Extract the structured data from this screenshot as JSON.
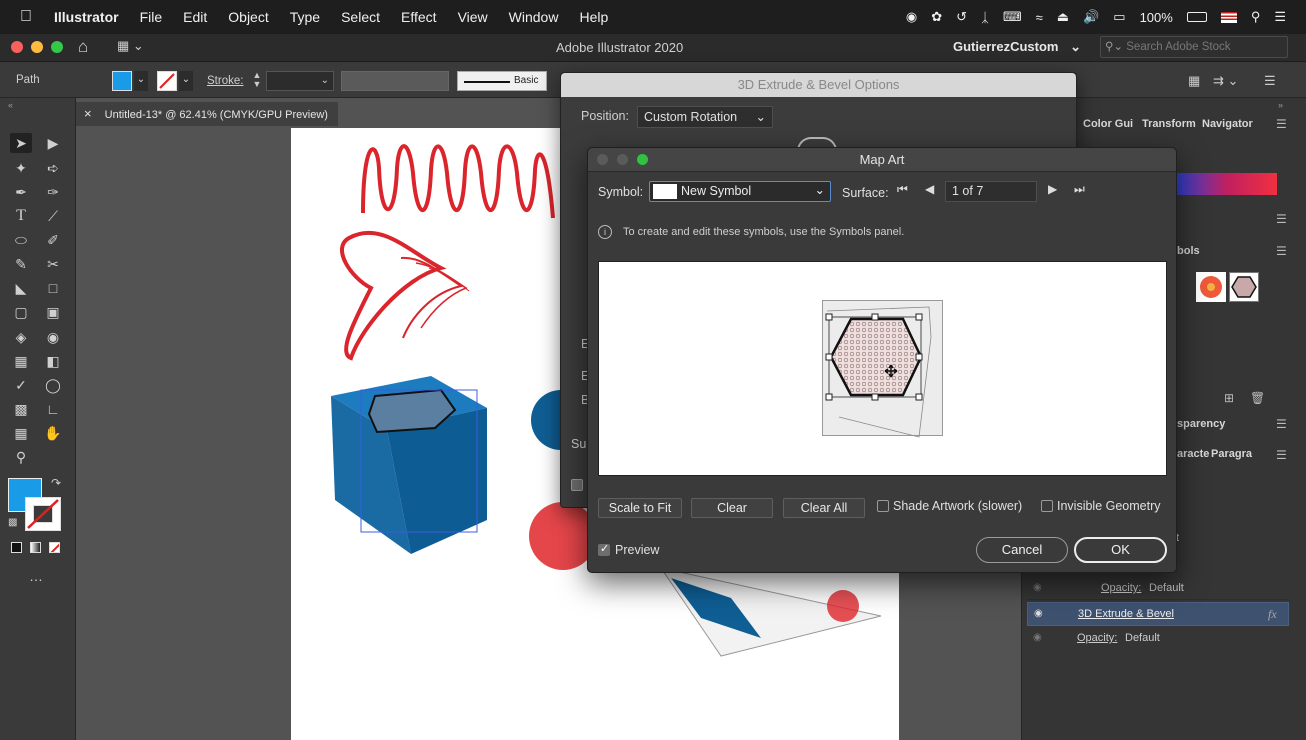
{
  "menubar": {
    "app_name": "Illustrator",
    "items": [
      "File",
      "Edit",
      "Object",
      "Type",
      "Select",
      "Effect",
      "View",
      "Window",
      "Help"
    ],
    "battery": "100%"
  },
  "titlebar": {
    "title": "Adobe Illustrator 2020",
    "workspace": "GutierrezCustom",
    "search_placeholder": "Search Adobe Stock"
  },
  "controlbar": {
    "selection_label": "Path",
    "stroke_label": "Stroke:",
    "brush_label": "Basic",
    "fill_color": "#1a9be8"
  },
  "document": {
    "tab_title": "Untitled-13* @ 62.41% (CMYK/GPU Preview)",
    "close_glyph": "×"
  },
  "dialog_3d": {
    "title": "3D Extrude & Bevel Options",
    "position_label": "Position:",
    "position_value": "Custom Rotation"
  },
  "map_art": {
    "title": "Map Art",
    "symbol_label": "Symbol:",
    "symbol_value": "New Symbol",
    "surface_label": "Surface:",
    "surface_value": "1 of 7",
    "info_text": "To create and edit these symbols, use the Symbols panel.",
    "buttons": {
      "scale_to_fit": "Scale to Fit",
      "clear": "Clear",
      "clear_all": "Clear All",
      "cancel": "Cancel",
      "ok": "OK"
    },
    "options": {
      "shade_artwork": "Shade Artwork (slower)",
      "shade_artwork_checked": false,
      "invisible_geometry": "Invisible Geometry",
      "invisible_geometry_checked": false,
      "preview": "Preview",
      "preview_checked": true
    }
  },
  "right_panel": {
    "tabs_top": [
      "Color Gui",
      "Transform",
      "Navigator"
    ],
    "symbols_tab": "bols",
    "transparency_tab": "sparency",
    "char_tabs": [
      "aracte",
      "Paragra"
    ],
    "appearance_rows": [
      {
        "label": "Opacity:",
        "value": "Default"
      },
      {
        "label": "3D Extrude & Bevel",
        "value": "fx"
      },
      {
        "label": "Opacity:",
        "value": "Default"
      }
    ],
    "stray_text": "t"
  },
  "dialog_3d_stray_labels": [
    "E",
    "E",
    "B",
    "Su"
  ]
}
